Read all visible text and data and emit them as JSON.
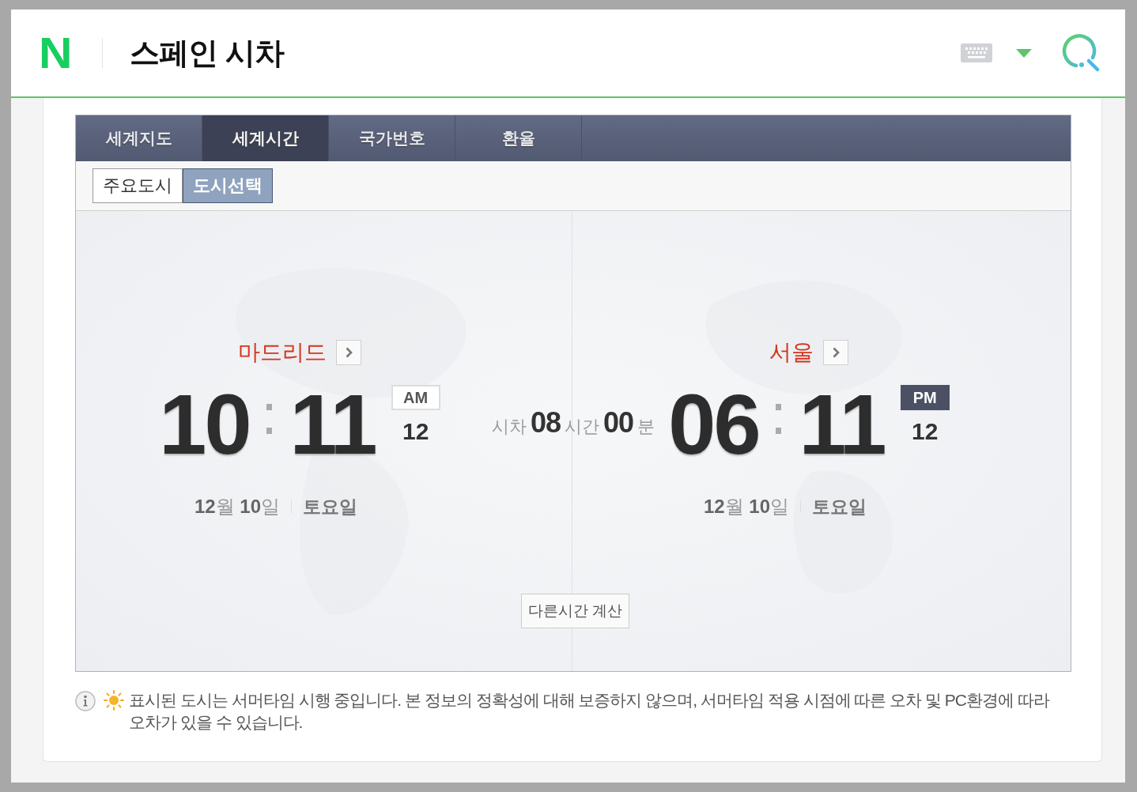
{
  "header": {
    "logo": "N",
    "title": "스페인 시차"
  },
  "tabs": [
    {
      "label": "세계지도",
      "selected": false
    },
    {
      "label": "세계시간",
      "selected": true
    },
    {
      "label": "국가번호",
      "selected": false
    },
    {
      "label": "환율",
      "selected": false
    }
  ],
  "subtabs": [
    {
      "label": "주요도시",
      "selected": false
    },
    {
      "label": "도시선택",
      "selected": true
    }
  ],
  "clocks": [
    {
      "city": "마드리드",
      "hour": "10",
      "minute": "11",
      "meridiem": "AM",
      "kind": "am",
      "second": "12",
      "date": "**12**월 **10**일",
      "weekday": "토요일"
    },
    {
      "city": "서울",
      "hour": "06",
      "minute": "11",
      "meridiem": "PM",
      "kind": "pm",
      "second": "12",
      "date": "**12**월 **10**일",
      "weekday": "토요일"
    }
  ],
  "difference": {
    "label": "시차",
    "hours": "08",
    "hours_unit": "시간",
    "minutes": "00",
    "minutes_unit": "분"
  },
  "calc_button": "다른시간 계산",
  "notice": "표시된 도시는 서머타임 시행 중입니다. 본 정보의 정확성에 대해 보증하지 않으며, 서머타임 적용 시점에 따른 오차 및 PC환경에 따라 오차가 있을 수 있습니다."
}
